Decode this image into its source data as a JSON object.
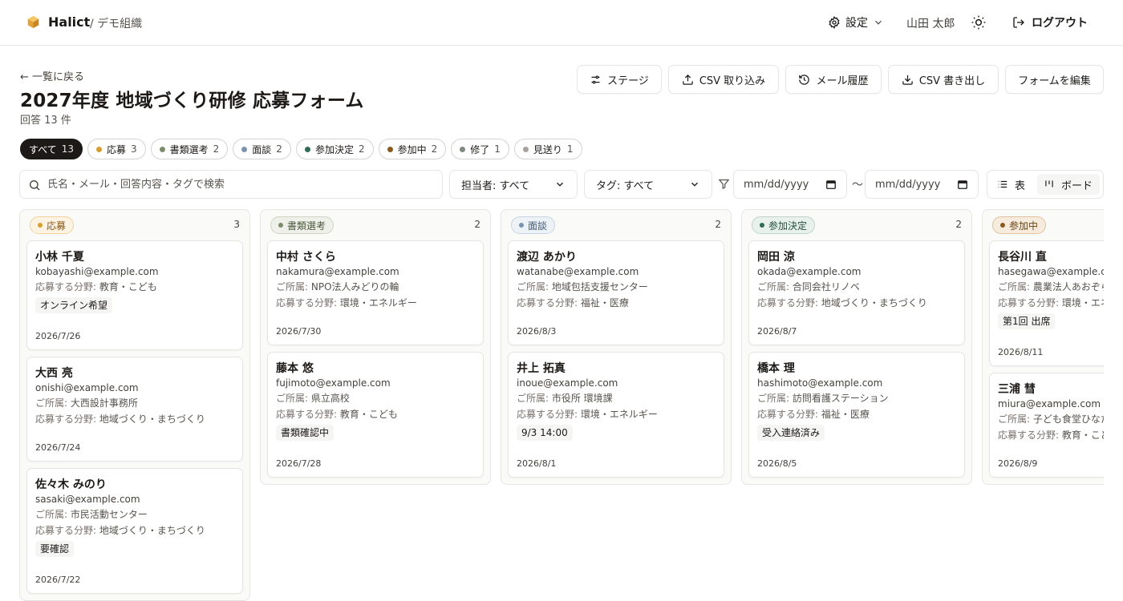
{
  "header": {
    "brand": "Halict",
    "org": "/ デモ組織",
    "settings_label": "設定",
    "user_name": "山田 太郎",
    "logout_label": "ログアウト"
  },
  "page": {
    "back_label": "← 一覧に戻る",
    "title": "2027年度 地域づくり研修 応募フォーム",
    "response_count": "回答 13 件"
  },
  "toolbar": {
    "stage": "ステージ",
    "csv_import": "CSV 取り込み",
    "mail_history": "メール履歴",
    "csv_export": "CSV 書き出し",
    "edit_form": "フォームを編集"
  },
  "filters": {
    "chips": [
      {
        "label": "すべて",
        "count": "13",
        "color": ""
      },
      {
        "label": "応募",
        "count": "3",
        "color": "#d69e2e"
      },
      {
        "label": "書類選考",
        "count": "2",
        "color": "#7c8c6a"
      },
      {
        "label": "面談",
        "count": "2",
        "color": "#7a94b0"
      },
      {
        "label": "参加決定",
        "count": "2",
        "color": "#2f6b55"
      },
      {
        "label": "参加中",
        "count": "2",
        "color": "#8a5a1c"
      },
      {
        "label": "修了",
        "count": "1",
        "color": "#7d8a7e"
      },
      {
        "label": "見送り",
        "count": "1",
        "color": "#a8a29e"
      }
    ],
    "search_placeholder": "氏名・メール・回答内容・タグで検索",
    "assignee": "担当者: すべて",
    "tag": "タグ: すべて",
    "date_from": "mm/dd/yyyy",
    "date_sep": "〜",
    "date_to": "mm/dd/yyyy",
    "view_table": "表",
    "view_board": "ボード"
  },
  "labels": {
    "affiliation": "ご所属: ",
    "field": "応募する分野: "
  },
  "board": {
    "columns": [
      {
        "stage": "応募",
        "count": "3",
        "badge_bg": "#fdf3e2",
        "badge_border": "#f0d39a",
        "badge_color": "#8a5a1c",
        "dot": "#d69e2e",
        "cards": [
          {
            "name": "小林 千夏",
            "email": "kobayashi@example.com",
            "affiliation": "",
            "field": "教育・こども",
            "tag": "オンライン希望",
            "date": "2026/7/26"
          },
          {
            "name": "大西 亮",
            "email": "onishi@example.com",
            "affiliation": "大西設計事務所",
            "field": "地域づくり・まちづくり",
            "tag": "",
            "date": "2026/7/24"
          },
          {
            "name": "佐々木 みのり",
            "email": "sasaki@example.com",
            "affiliation": "市民活動センター",
            "field": "地域づくり・まちづくり",
            "tag": "要確認",
            "date": "2026/7/22"
          }
        ]
      },
      {
        "stage": "書類選考",
        "count": "2",
        "badge_bg": "#eef0e9",
        "badge_border": "#cfd4c4",
        "badge_color": "#4d5a3f",
        "dot": "#7c8c6a",
        "cards": [
          {
            "name": "中村 さくら",
            "email": "nakamura@example.com",
            "affiliation": "NPO法人みどりの輪",
            "field": "環境・エネルギー",
            "tag": "",
            "date": "2026/7/30"
          },
          {
            "name": "藤本 悠",
            "email": "fujimoto@example.com",
            "affiliation": "県立高校",
            "field": "教育・こども",
            "tag": "書類確認中",
            "date": "2026/7/28"
          }
        ]
      },
      {
        "stage": "面談",
        "count": "2",
        "badge_bg": "#edf2f7",
        "badge_border": "#c9d5e3",
        "badge_color": "#3f5873",
        "dot": "#7a94b0",
        "cards": [
          {
            "name": "渡辺 あかり",
            "email": "watanabe@example.com",
            "affiliation": "地域包括支援センター",
            "field": "福祉・医療",
            "tag": "",
            "date": "2026/8/3"
          },
          {
            "name": "井上 拓真",
            "email": "inoue@example.com",
            "affiliation": "市役所 環境課",
            "field": "環境・エネルギー",
            "tag": "9/3 14:00",
            "date": "2026/8/1"
          }
        ]
      },
      {
        "stage": "参加決定",
        "count": "2",
        "badge_bg": "#e8f1ec",
        "badge_border": "#bcd6c8",
        "badge_color": "#234f3f",
        "dot": "#2f6b55",
        "cards": [
          {
            "name": "岡田 涼",
            "email": "okada@example.com",
            "affiliation": "合同会社リノベ",
            "field": "地域づくり・まちづくり",
            "tag": "",
            "date": "2026/8/7"
          },
          {
            "name": "橋本 理",
            "email": "hashimoto@example.com",
            "affiliation": "訪問看護ステーション",
            "field": "福祉・医療",
            "tag": "受入連絡済み",
            "date": "2026/8/5"
          }
        ]
      },
      {
        "stage": "参加中",
        "count": "",
        "badge_bg": "#f6ebdd",
        "badge_border": "#dfc29d",
        "badge_color": "#6b4413",
        "dot": "#8a5a1c",
        "cards": [
          {
            "name": "長谷川 直",
            "email": "hasegawa@example.com",
            "affiliation": "農業法人あおぞら",
            "field": "環境・エネルギー",
            "tag": "第1回 出席",
            "date": "2026/8/11"
          },
          {
            "name": "三浦 彗",
            "email": "miura@example.com",
            "affiliation": "子ども食堂ひなた",
            "field": "教育・こども",
            "tag": "",
            "date": "2026/8/9"
          }
        ]
      }
    ]
  }
}
